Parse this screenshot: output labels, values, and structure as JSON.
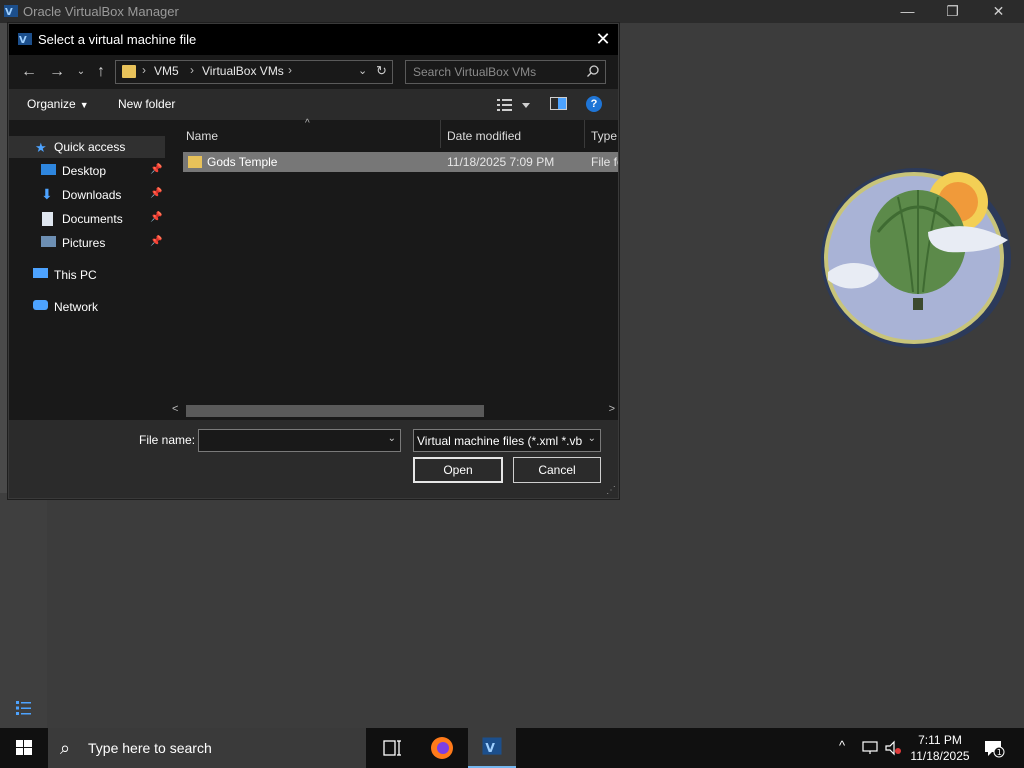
{
  "app": {
    "title": "Oracle VirtualBox Manager",
    "minimize": "—",
    "restore": "❐",
    "close": "✕"
  },
  "dialog": {
    "title": "Select a virtual machine file",
    "close": "✕",
    "breadcrumb": [
      "VM5",
      "VirtualBox VMs"
    ],
    "search_placeholder": "Search VirtualBox VMs",
    "toolbar": {
      "organize": "Organize",
      "new_folder": "New folder"
    },
    "nav": {
      "quick_access": "Quick access",
      "desktop": "Desktop",
      "downloads": "Downloads",
      "documents": "Documents",
      "pictures": "Pictures",
      "this_pc": "This PC",
      "network": "Network"
    },
    "columns": {
      "name": "Name",
      "date": "Date modified",
      "type": "Type"
    },
    "files": [
      {
        "name": "Gods Temple",
        "date": "11/18/2025 7:09 PM",
        "type": "File folder"
      }
    ],
    "file_name_label": "File name:",
    "file_name_value": "",
    "filter": "Virtual machine files (*.xml *.vbox)",
    "open": "Open",
    "cancel": "Cancel"
  },
  "taskbar": {
    "search_placeholder": "Type here to search",
    "time": "7:11 PM",
    "date": "11/18/2025",
    "notification_count": "1"
  },
  "colors": {
    "dialog_bg": "#2b2b2b",
    "pane_bg": "#191919",
    "selected_row": "#777777",
    "folder": "#e8c25a",
    "accent": "#1f75d6"
  }
}
